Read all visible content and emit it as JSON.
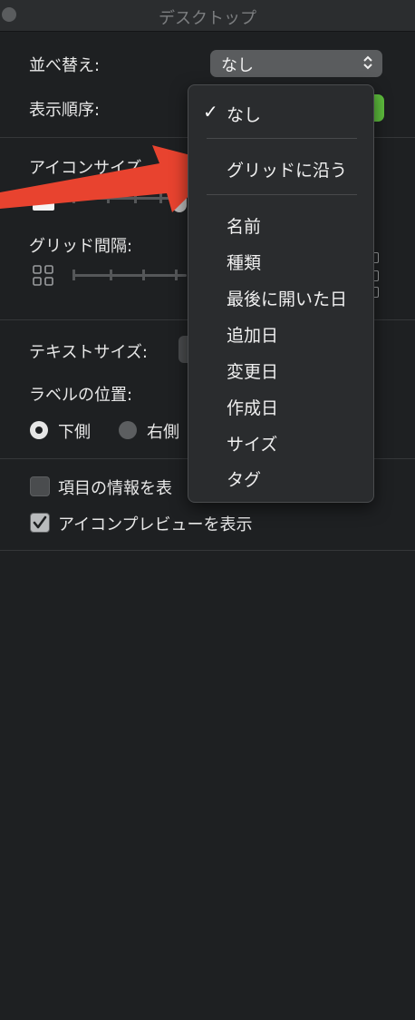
{
  "window": {
    "title": "デスクトップ"
  },
  "sort": {
    "label": "並べ替え:",
    "value": "なし"
  },
  "display_order": {
    "label": "表示順序:"
  },
  "icon_size": {
    "label": "アイコンサイズ"
  },
  "grid_spacing": {
    "label": "グリッド間隔:"
  },
  "text_size": {
    "label": "テキストサイズ:"
  },
  "label_position": {
    "label": "ラベルの位置:",
    "options": [
      {
        "label": "下側",
        "selected": true
      },
      {
        "label": "右側",
        "selected": false
      }
    ]
  },
  "checkboxes": [
    {
      "label": "項目の情報を表",
      "checked": false
    },
    {
      "label": "アイコンプレビューを表示",
      "checked": true
    }
  ],
  "dropdown": {
    "check_symbol": "✓",
    "items": [
      "なし",
      "グリッドに沿う",
      "名前",
      "種類",
      "最後に開いた日",
      "追加日",
      "変更日",
      "作成日",
      "サイズ",
      "タグ"
    ]
  },
  "colors": {
    "arrow": "#e8432f",
    "toggle_green": "#5fbf3e",
    "background": "#1e2022"
  }
}
